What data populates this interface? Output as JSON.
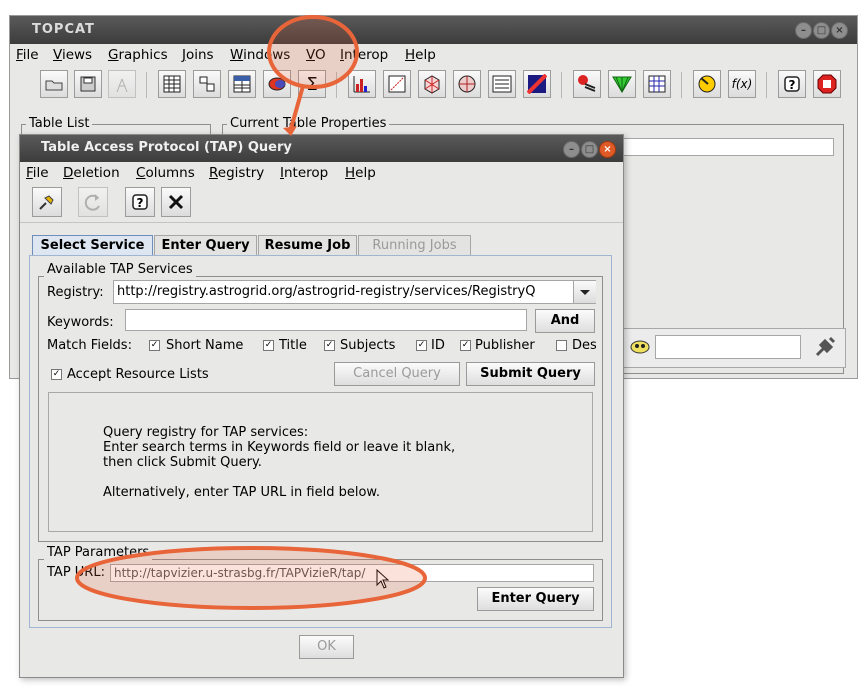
{
  "main": {
    "title": "TOPCAT",
    "menu": [
      "File",
      "Views",
      "Graphics",
      "Joins",
      "Windows",
      "VO",
      "Interop",
      "Help"
    ],
    "toolbar_icons": [
      "open-icon",
      "save-icon",
      "broadcast-icon",
      "table-icon",
      "columns-icon",
      "parameters-icon",
      "subsets-icon",
      "statistics-icon",
      "histogram-icon",
      "plot2d-icon",
      "plot3d-icon",
      "sphere-icon",
      "stilts-icon",
      "density-icon",
      "concat-icon",
      "match-icon",
      "pair-icon",
      "cone-icon",
      "function-icon",
      "help-icon",
      "exit-icon"
    ],
    "table_list_label": "Table List",
    "current_props_label": "Current Table Properties"
  },
  "tap": {
    "title": "Table Access Protocol (TAP) Query",
    "menu": [
      "File",
      "Deletion",
      "Columns",
      "Registry",
      "Interop",
      "Help"
    ],
    "tabs": [
      "Select Service",
      "Enter Query",
      "Resume Job",
      "Running Jobs"
    ],
    "available_label": "Available TAP Services",
    "registry_label": "Registry:",
    "registry_value": "http://registry.astrogrid.org/astrogrid-registry/services/RegistryQ",
    "keywords_label": "Keywords:",
    "keywords_value": "",
    "and_label": "And",
    "match_fields_label": "Match Fields:",
    "match_fields": [
      {
        "label": "Short Name",
        "checked": true
      },
      {
        "label": "Title",
        "checked": true
      },
      {
        "label": "Subjects",
        "checked": true
      },
      {
        "label": "ID",
        "checked": true
      },
      {
        "label": "Publisher",
        "checked": true
      },
      {
        "label": "Des",
        "checked": false
      }
    ],
    "accept_lists_label": "Accept Resource Lists",
    "accept_lists_checked": true,
    "cancel_query_label": "Cancel Query",
    "submit_query_label": "Submit Query",
    "info_lines": [
      "Query registry for TAP services:",
      "Enter search terms in Keywords field or leave it blank,",
      "then click Submit Query.",
      "",
      "Alternatively, enter TAP URL in field below."
    ],
    "params_label": "TAP Parameters",
    "tap_url_label": "TAP URL:",
    "tap_url_value": "http://tapvizier.u-strasbg.fr/TAPVizieR/tap/",
    "enter_query_label": "Enter Query",
    "ok_label": "OK"
  },
  "colors": {
    "annotation": "#e8653a",
    "annotation_fill": "rgba(232,101,58,0.18)"
  }
}
